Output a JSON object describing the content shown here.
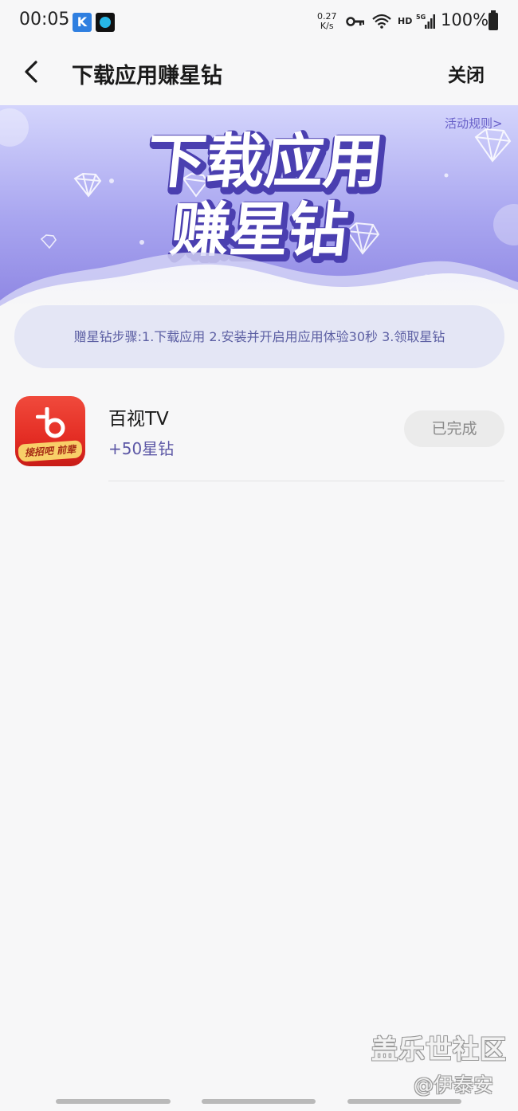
{
  "status_bar": {
    "time": "00:05",
    "app_icon_k": "K",
    "net_speed_value": "0.27",
    "net_speed_unit": "K/s",
    "hd": "HD",
    "network_type": "5G",
    "battery": "100%"
  },
  "nav": {
    "title": "下载应用赚星钻",
    "close_label": "关闭"
  },
  "banner": {
    "rules_link": "活动规则>",
    "headline_line1": "下载应用",
    "headline_line2": "赚星钻",
    "colors": {
      "bg_top": "#cfd0fb",
      "bg_bottom": "#9088e6",
      "text": "#ffffff",
      "text_shadow": "#4f43b5"
    }
  },
  "steps_text": "赠星钻步骤:1.下载应用 2.安装并开启用应用体验30秒 3.领取星钻",
  "apps": [
    {
      "name": "百视TV",
      "reward": "+50星钻",
      "status": "已完成",
      "icon_caption": "接招吧 前辈",
      "icon": "baishi-tv-icon"
    }
  ],
  "watermark": {
    "line1": "盖乐世社区",
    "line2": "@伊泰安"
  }
}
